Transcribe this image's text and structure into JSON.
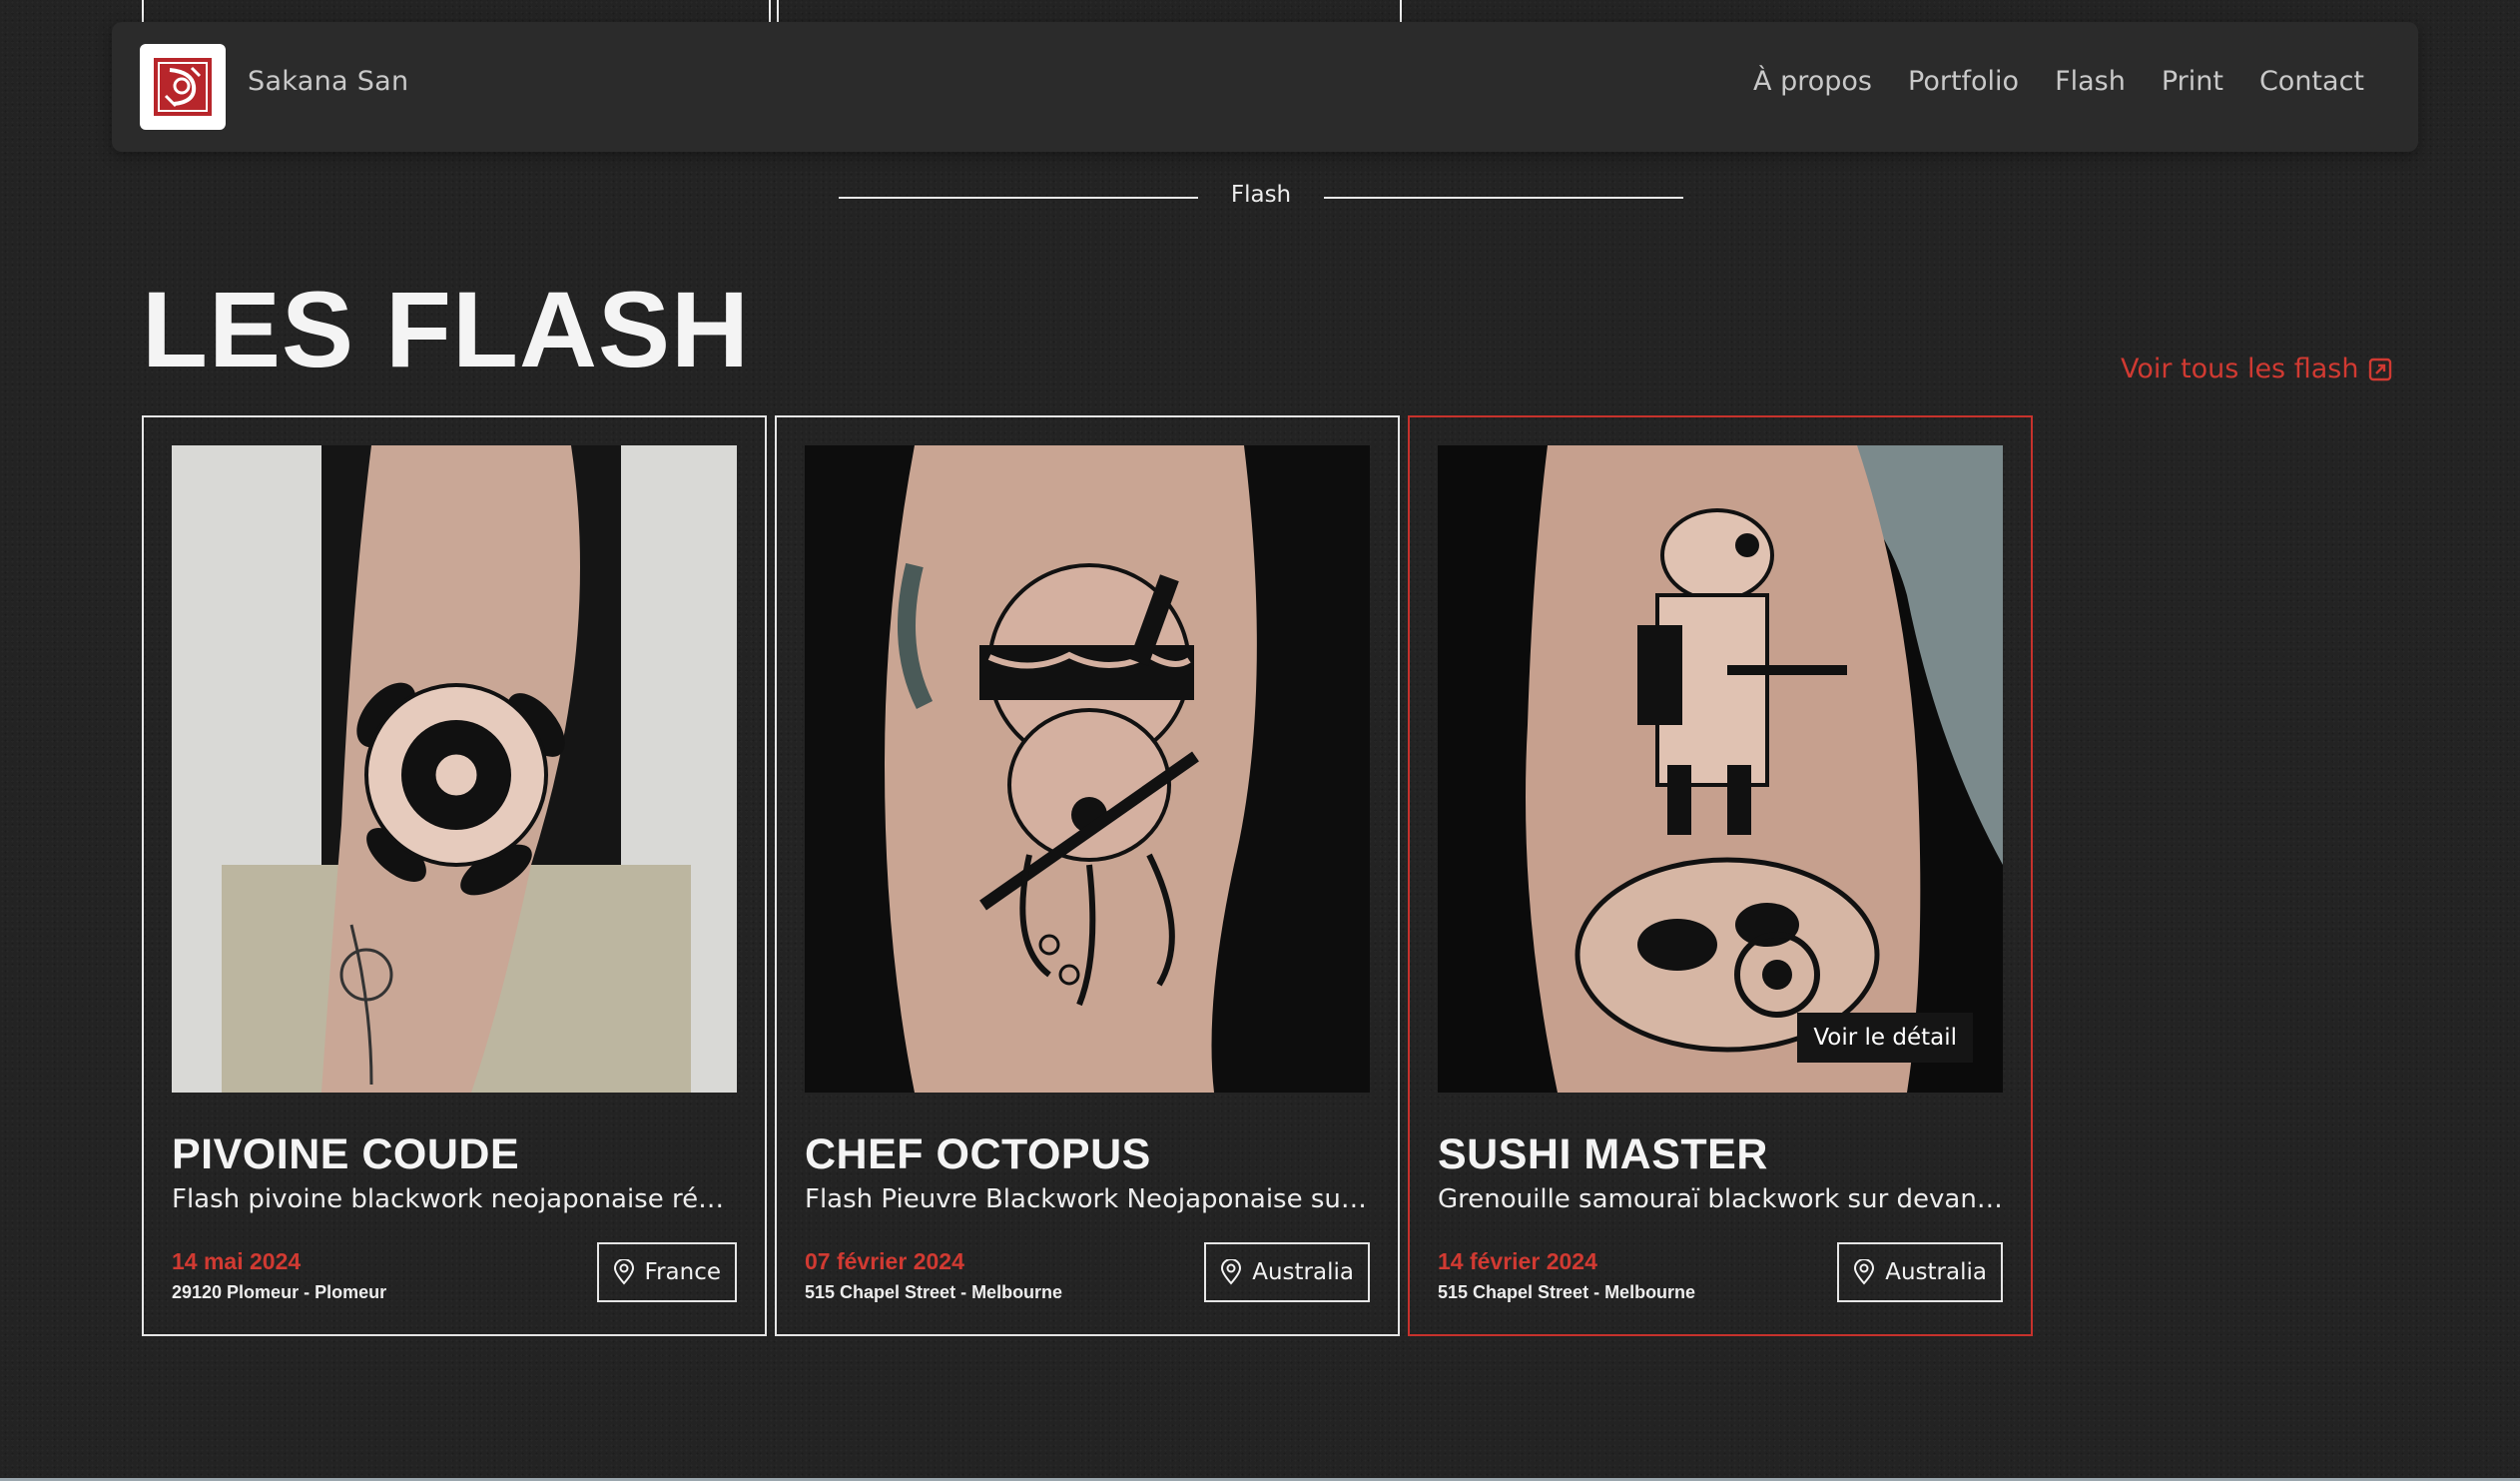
{
  "header": {
    "brand": "Sakana San",
    "nav": [
      "À propos",
      "Portfolio",
      "Flash",
      "Print",
      "Contact"
    ]
  },
  "section_label": "Flash",
  "page_title": "LES FLASH",
  "see_all": "Voir tous les flash",
  "detail_label": "Voir le détail",
  "cards": [
    {
      "title": "PIVOINE COUDE",
      "description": "Flash pivoine blackwork neojaponaise réalisé au coude",
      "date": "14 mai 2024",
      "address": "29120 Plomeur - Plomeur",
      "location": "France"
    },
    {
      "title": "CHEF OCTOPUS",
      "description": "Flash Pieuvre Blackwork Neojaponaise sur le mollet",
      "date": "07 février 2024",
      "address": "515 Chapel Street - Melbourne",
      "location": "Australia"
    },
    {
      "title": "SUSHI MASTER",
      "description": "Grenouille samouraï blackwork sur devant du bras",
      "date": "14 février 2024",
      "address": "515 Chapel Street - Melbourne",
      "location": "Australia"
    }
  ],
  "colors": {
    "accent": "#d13a32",
    "background": "#232323",
    "header": "#2b2b2b"
  }
}
